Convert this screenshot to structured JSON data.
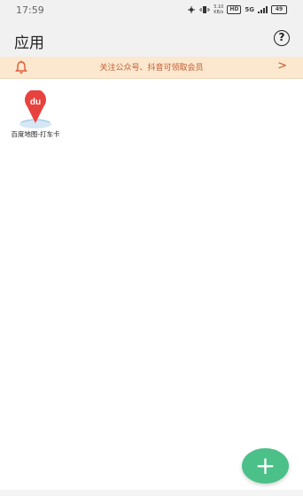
{
  "status_bar": {
    "time": "17:59",
    "speed_value": "5.10",
    "speed_unit": "KB/s",
    "hd_badge": "HD",
    "network": "5G",
    "battery": "49"
  },
  "header": {
    "title": "应用",
    "help_icon": "?"
  },
  "notice": {
    "text": "关注公众号、抖音可领取会员",
    "arrow": ">"
  },
  "apps": [
    {
      "logo_text": "du",
      "label": "百度地图-打车卡",
      "icon": "baidu-map-icon"
    }
  ],
  "fab": {
    "symbol": "+"
  },
  "colors": {
    "accent_green": "#4cc089",
    "notice_bg": "#fbe8cf",
    "notice_text": "#c35a2f",
    "baidu_red": "#e8423f"
  }
}
